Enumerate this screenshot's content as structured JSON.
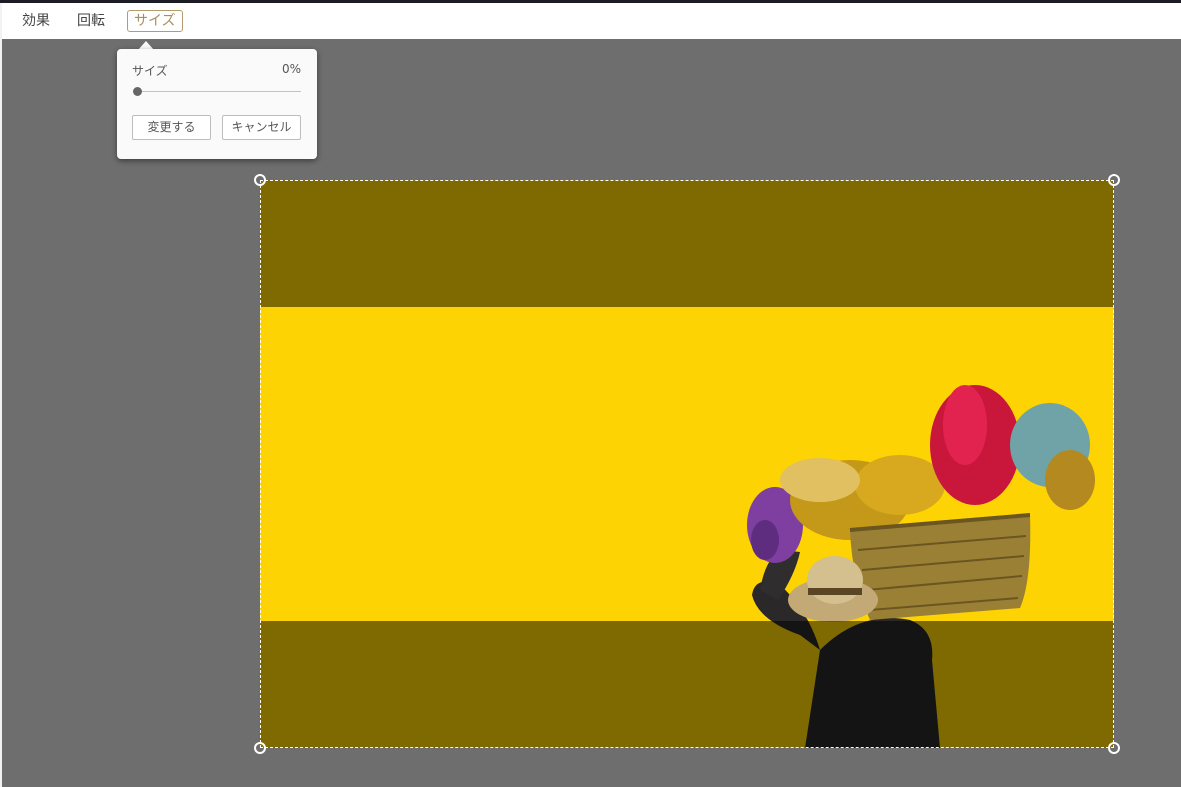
{
  "toolbar": {
    "items": [
      {
        "label": "効果"
      },
      {
        "label": "回転"
      },
      {
        "label": "サイズ",
        "active": true
      }
    ]
  },
  "size_popover": {
    "label": "サイズ",
    "value_text": "0%",
    "slider_value_percent": 0,
    "apply_label": "変更する",
    "cancel_label": "キャンセル"
  },
  "colors": {
    "accent": "#a88e5f",
    "canvas_background": "#6e6e6e",
    "photo_wall": "#fed303"
  },
  "icons": [
    "crop-corner-handle"
  ]
}
